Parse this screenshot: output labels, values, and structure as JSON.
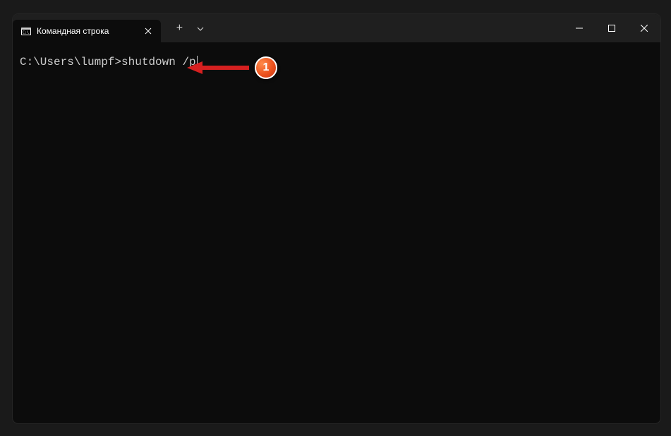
{
  "tab": {
    "title": "Командная строка"
  },
  "terminal": {
    "prompt": "C:\\Users\\lumpf>",
    "command": "shutdown /p"
  },
  "annotation": {
    "badge": "1"
  }
}
